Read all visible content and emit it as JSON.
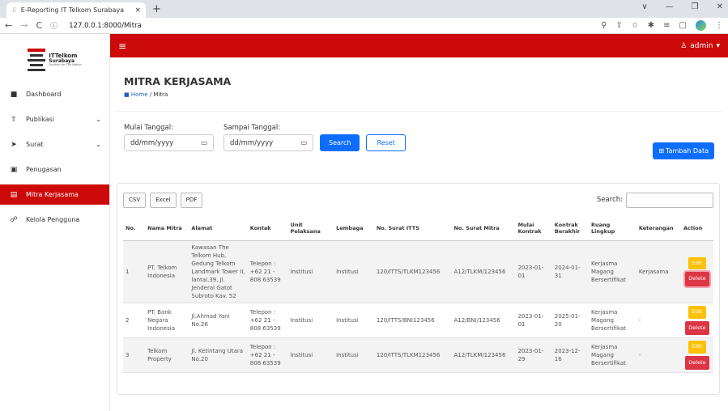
{
  "browser": {
    "tab_title": "E-Reporting IT Telkom Surabaya",
    "tab_close": "×",
    "new_tab": "+",
    "url": "127.0.0.1:8000/Mitra",
    "window_controls": [
      "∨",
      "—",
      "❐",
      "✕"
    ]
  },
  "sidebar": {
    "logo": {
      "line1": "ITTelkom",
      "line2": "Surabaya",
      "line3": "Solution for The Nation"
    },
    "items": [
      {
        "label": "Dashboard",
        "icon": "grid-icon"
      },
      {
        "label": "Publikasi",
        "icon": "upload-icon",
        "caret": "⌄"
      },
      {
        "label": "Surat",
        "icon": "send-icon",
        "caret": "⌄"
      },
      {
        "label": "Penugasan",
        "icon": "clipboard-icon"
      },
      {
        "label": "Mitra Kerjasama",
        "icon": "card-icon",
        "active": true
      },
      {
        "label": "Kelola Pengguna",
        "icon": "users-icon"
      }
    ]
  },
  "topbar": {
    "user": "admin",
    "user_caret": "▾",
    "accent": "#cc0a0a"
  },
  "page": {
    "title": "MITRA KERJASAMA",
    "breadcrumb_home": "Home",
    "breadcrumb_current": "/ Mitra"
  },
  "filter": {
    "start_label": "Mulai Tanggal:",
    "end_label": "Sampai Tanggal:",
    "date_placeholder": "dd/mm/yyyy",
    "search_button": "Search",
    "reset_button": "Reset",
    "add_button": "Tambah Data"
  },
  "table_tools": {
    "export": [
      "CSV",
      "Excel",
      "PDF"
    ],
    "search_label": "Search:"
  },
  "table": {
    "headers": [
      "No.",
      "Nama Mitra",
      "Alamat",
      "Kontak",
      "Unit Pelaksana",
      "Lembaga",
      "No. Surat ITTS",
      "No. Surat Mitra",
      "Mulai Kontrak",
      "Kontrak Berakhir",
      "Ruang Lingkup",
      "Keterangan",
      "Action"
    ],
    "rows": [
      {
        "no": "1",
        "nama": "PT. Telkom Indonesia",
        "alamat": "Kawasan The Telkom Hub, Gedung Telkom Landmark Tower II, lantai.39, Jl. Jenderal Gatot Subroto Kav. 52",
        "kontak": "Telepon : +62 21 - 808 63539",
        "unit": "Institusi",
        "lembaga": "Institusi",
        "surat_itts": "120/ITTS/TLKM123456",
        "surat_mitra": "A12/TLKM/123456",
        "mulai": "2023-01-01",
        "berakhir": "2024-01-31",
        "ruang": "Kerjasma Magang Bersertifikat",
        "keterangan": "Kerjasama"
      },
      {
        "no": "2",
        "nama": "PT. Bank Negara Indonesia",
        "alamat": "Jl.Ahmad Yani No.26",
        "kontak": "Telepon : +62 21 - 808 63539",
        "unit": "Institusi",
        "lembaga": "Institusi",
        "surat_itts": "120/ITTS/BNI123456",
        "surat_mitra": "A12/BNI/123456",
        "mulai": "2023-01-01",
        "berakhir": "2025-01-20",
        "ruang": "Kerjasma Magang Bersertifikat",
        "keterangan": "-"
      },
      {
        "no": "3",
        "nama": "Telkom Property",
        "alamat": "Jl. Ketintang Utara No.20",
        "kontak": "Telepon : +62 21 - 808 63539",
        "unit": "Institusi",
        "lembaga": "Institusi",
        "surat_itts": "120/ITTS/TLKM123456",
        "surat_mitra": "A12/TLKM/123456",
        "mulai": "2023-01-29",
        "berakhir": "2023-12-16",
        "ruang": "Kerjasma Magang Bersertifikat",
        "keterangan": "-"
      }
    ],
    "edit_label": "Edit",
    "delete_label": "Delete"
  }
}
